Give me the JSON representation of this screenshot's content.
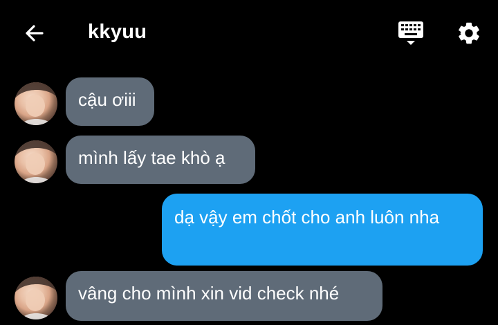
{
  "header": {
    "title": "kkyuu",
    "icons": {
      "back": "arrow-left-icon",
      "keyboard": "keyboard-icon",
      "settings": "gear-icon"
    }
  },
  "messages": [
    {
      "direction": "incoming",
      "text": "cậu ơiii"
    },
    {
      "direction": "incoming",
      "text": "mình lấy tae khò ạ"
    },
    {
      "direction": "outgoing",
      "text": "dạ vậy em chốt cho anh luôn nha"
    },
    {
      "direction": "incoming",
      "text": "vâng cho mình xin vid check nhé"
    }
  ],
  "colors": {
    "background": "#000000",
    "incoming_bubble": "#5f6b78",
    "outgoing_bubble": "#1da1f2",
    "text": "#ffffff"
  }
}
